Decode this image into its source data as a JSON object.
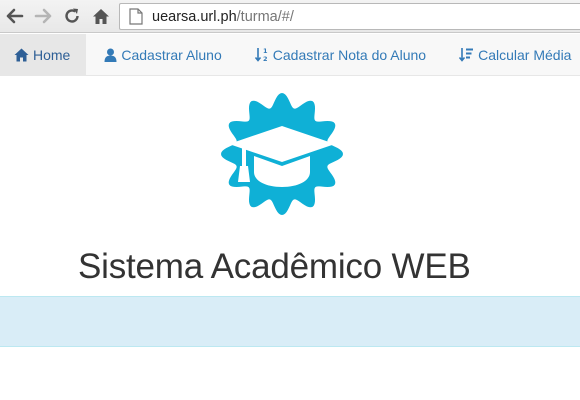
{
  "browser": {
    "url_host": "uearsa.url.ph",
    "url_path": "/turma/#/"
  },
  "navbar": {
    "items": [
      {
        "label": "Home",
        "icon": "home-icon",
        "active": true
      },
      {
        "label": "Cadastrar Aluno",
        "icon": "user-icon",
        "active": false
      },
      {
        "label": "Cadastrar Nota do Aluno",
        "icon": "sort-numeric-icon",
        "active": false
      },
      {
        "label": "Calcular Média",
        "icon": "sort-attributes-icon",
        "active": false
      }
    ]
  },
  "main": {
    "logo": "graduation-cap-badge-icon",
    "title": "Sistema Acadêmico WEB"
  },
  "colors": {
    "link": "#337ab7",
    "logo": "#0fb0d6",
    "info_band": "#d9edf7",
    "navbar_bg": "#f8f8f8"
  }
}
